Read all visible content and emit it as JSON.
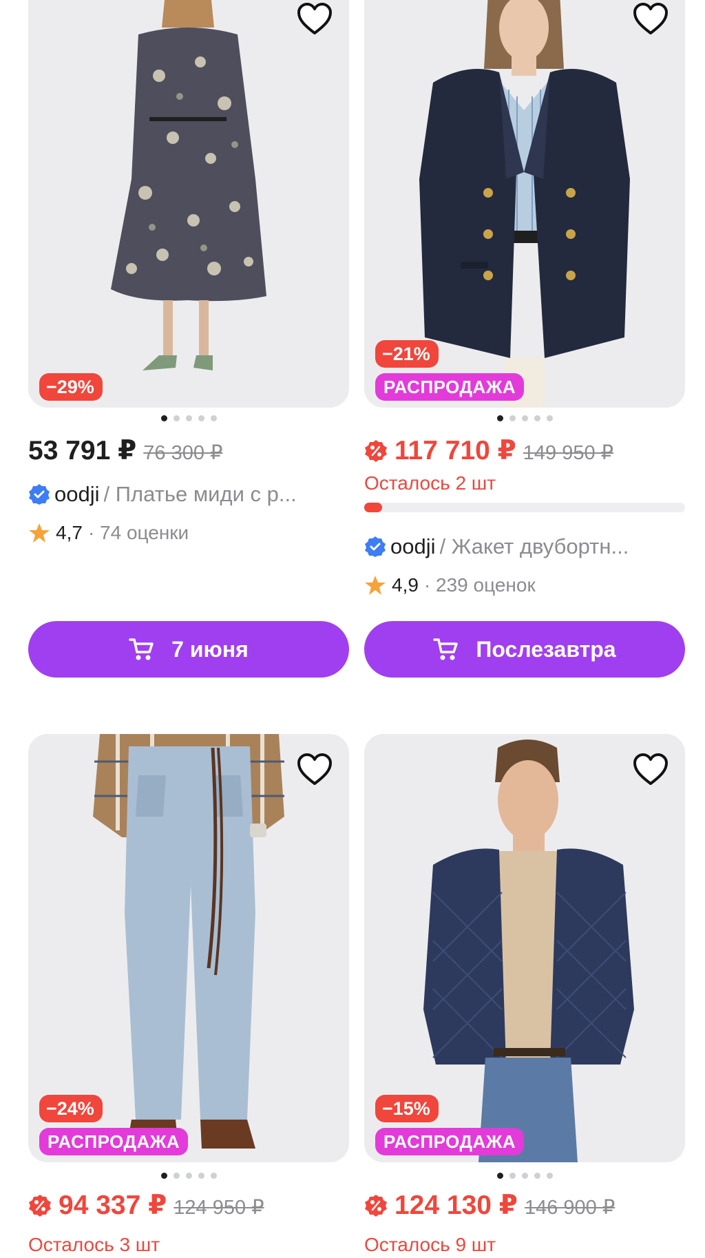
{
  "colors": {
    "accent_purple": "#a03ff0",
    "discount_red": "#f0463c",
    "sale_pink": "#e23bd9",
    "verified_blue": "#3d7df5",
    "star_orange": "#f5a33a"
  },
  "products": [
    {
      "discount": "−29%",
      "sale_label": "",
      "price": "53 791 ₽",
      "old_price": "76 300 ₽",
      "stock_text": "",
      "brand": "oodji",
      "title": "/ Платье миди с р...",
      "rating": "4,7",
      "reviews": "· 74 оценки",
      "button_label": "7 июня",
      "image": "woman-floral-midi-dress-photo"
    },
    {
      "discount": "−21%",
      "sale_label": "РАСПРОДАЖА",
      "price": "117 710 ₽",
      "old_price": "149 950 ₽",
      "stock_text": "Осталось 2 шт",
      "stock_level": 0.05,
      "brand": "oodji",
      "title": "/ Жакет двубортн...",
      "rating": "4,9",
      "reviews": "· 239 оценок",
      "button_label": "Послезавтра",
      "image": "woman-navy-double-breasted-blazer-photo"
    },
    {
      "discount": "−24%",
      "sale_label": "РАСПРОДАЖА",
      "price": "94 337 ₽",
      "old_price": "124 950 ₽",
      "stock_text": "Осталось 3 шт",
      "image": "woman-light-wide-jeans-photo"
    },
    {
      "discount": "−15%",
      "sale_label": "РАСПРОДАЖА",
      "price": "124 130 ₽",
      "old_price": "146 900 ₽",
      "stock_text": "Осталось 9 шт",
      "image": "man-quilted-navy-bomber-photo"
    }
  ],
  "icons": {
    "favorite": "heart-outline-icon",
    "cart": "cart-icon",
    "verified": "verified-check-icon",
    "star": "star-icon",
    "promo": "percent-promo-icon"
  }
}
